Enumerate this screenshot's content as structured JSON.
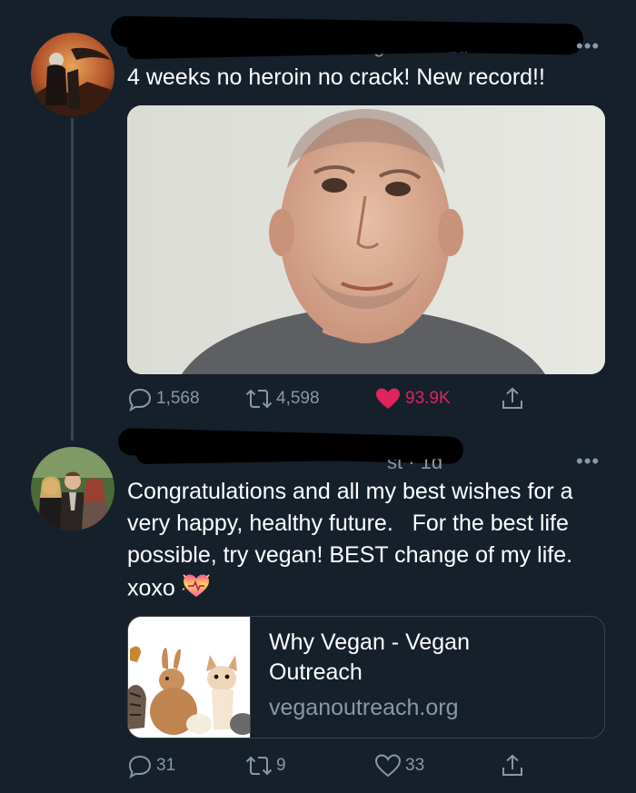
{
  "tweets": [
    {
      "meta_partial": "vegeuso · 1d",
      "text": "4 weeks no heroin no crack! New record!!",
      "stats": {
        "replies": "1,568",
        "retweets": "4,598",
        "likes": "93.9K"
      },
      "liked": true
    },
    {
      "meta_partial": "st · 1d",
      "text": "Congratulations and all my best wishes for a very happy, healthy future.   For the best life possible, try vegan! BEST change of my life.  xoxo",
      "emoji": "sparkling-heart-emoji",
      "link_card": {
        "title": "Why Vegan - Vegan Outreach",
        "domain": "veganoutreach.org"
      },
      "stats": {
        "replies": "31",
        "retweets": "9",
        "likes": "33"
      },
      "liked": false
    }
  ],
  "colors": {
    "background": "#15202b",
    "secondary_text": "#8899a6",
    "like_red": "#e0245e",
    "border": "#38444d"
  },
  "icons": [
    "reply-icon",
    "retweet-icon",
    "like-icon",
    "share-icon",
    "more-icon"
  ]
}
